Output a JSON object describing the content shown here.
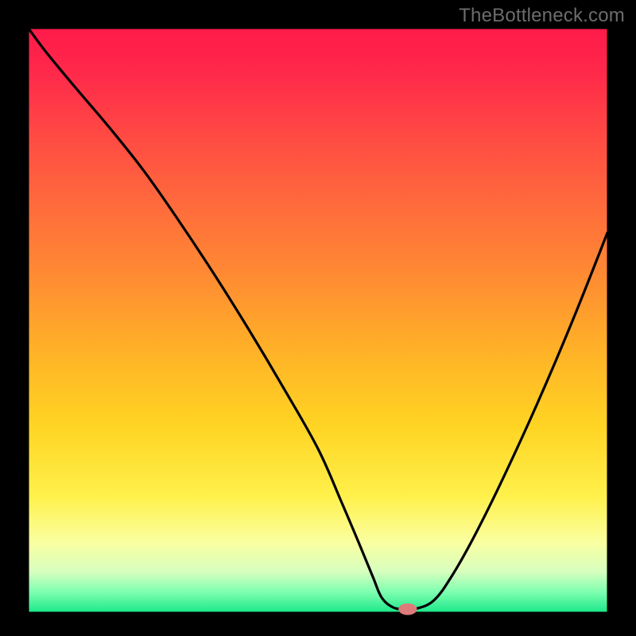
{
  "watermark": "TheBottleneck.com",
  "chart_data": {
    "type": "line",
    "title": "",
    "xlabel": "",
    "ylabel": "",
    "xlim": [
      0,
      100
    ],
    "ylim": [
      0,
      100
    ],
    "legend": false,
    "background_gradient": {
      "stops": [
        {
          "offset": 0.0,
          "color": "#ff1a4a"
        },
        {
          "offset": 0.08,
          "color": "#ff2a4a"
        },
        {
          "offset": 0.18,
          "color": "#ff4944"
        },
        {
          "offset": 0.3,
          "color": "#ff6a3c"
        },
        {
          "offset": 0.42,
          "color": "#ff8a33"
        },
        {
          "offset": 0.55,
          "color": "#ffb127"
        },
        {
          "offset": 0.68,
          "color": "#ffd423"
        },
        {
          "offset": 0.8,
          "color": "#fff04a"
        },
        {
          "offset": 0.88,
          "color": "#faffa0"
        },
        {
          "offset": 0.93,
          "color": "#d8ffbf"
        },
        {
          "offset": 0.965,
          "color": "#7fffb0"
        },
        {
          "offset": 1.0,
          "color": "#1ce88a"
        }
      ]
    },
    "series": [
      {
        "name": "bottleneck-curve",
        "color": "#000000",
        "x": [
          0,
          3,
          8,
          14,
          20,
          26,
          32,
          38,
          44,
          50,
          54,
          57,
          59.5,
          61,
          63,
          65,
          67,
          70,
          73,
          77,
          82,
          88,
          94,
          100
        ],
        "values": [
          100,
          96,
          90,
          83,
          75.5,
          67,
          58,
          48.5,
          38.5,
          28,
          19,
          12,
          6,
          2.5,
          0.8,
          0.5,
          0.6,
          2,
          6,
          13,
          23,
          36,
          50,
          65
        ]
      }
    ],
    "marker": {
      "name": "optimal-point",
      "x": 65.5,
      "y": 0.5,
      "rx": 1.6,
      "ry": 1.0,
      "color": "#dd7a7a"
    },
    "inner_border_color": "#000000"
  },
  "plot": {
    "outer_size": 800,
    "padX": 36,
    "padTop": 36,
    "padBottom": 30
  }
}
